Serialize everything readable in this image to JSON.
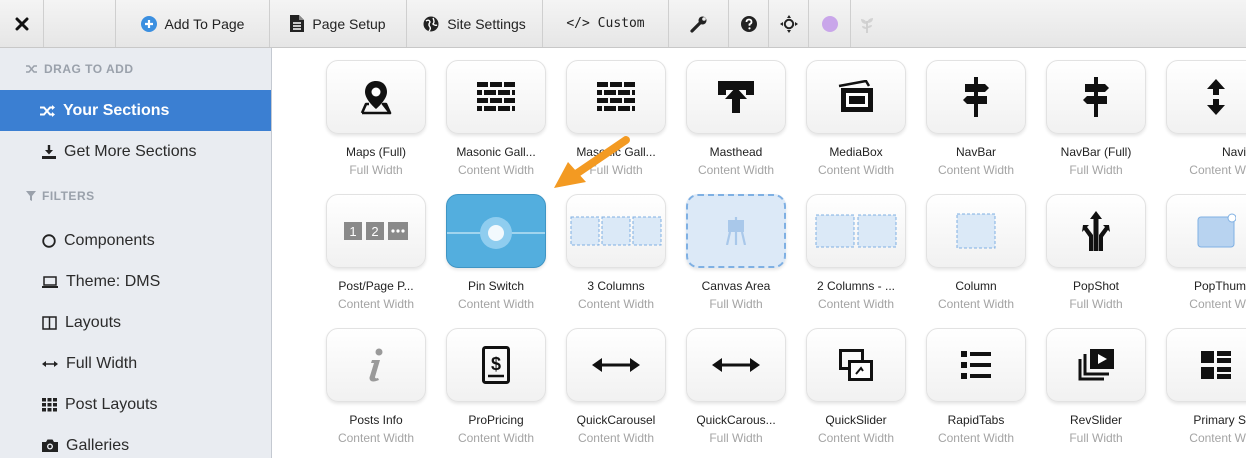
{
  "toolbar": {
    "add_label": "Add To Page",
    "setup_label": "Page Setup",
    "site_label": "Site Settings",
    "custom_label": "</> Custom"
  },
  "sidebar": {
    "drag_heading": "DRAG TO ADD",
    "filters_heading": "FILTERS",
    "items": [
      {
        "label": "Your Sections",
        "icon": "shuffle-icon"
      },
      {
        "label": "Get More Sections",
        "icon": "download-icon"
      },
      {
        "label": "Components",
        "icon": "circle-icon"
      },
      {
        "label": "Theme: DMS",
        "icon": "laptop-icon"
      },
      {
        "label": "Layouts",
        "icon": "columns-icon"
      },
      {
        "label": "Full Width",
        "icon": "arrows-horizontal-icon"
      },
      {
        "label": "Post Layouts",
        "icon": "grid-icon"
      },
      {
        "label": "Galleries",
        "icon": "camera-icon"
      }
    ]
  },
  "sections": {
    "rows": [
      [
        {
          "name": "Maps (Full)",
          "sub": "Full Width",
          "icon": "map-pin-icon"
        },
        {
          "name": "Masonic Gall...",
          "sub": "Content Width",
          "icon": "brick-wall-icon"
        },
        {
          "name": "Masonic Gall...",
          "sub": "Full Width",
          "icon": "brick-wall-icon"
        },
        {
          "name": "Masthead",
          "sub": "Content Width",
          "icon": "masthead-icon"
        },
        {
          "name": "MediaBox",
          "sub": "Content Width",
          "icon": "media-box-icon"
        },
        {
          "name": "NavBar",
          "sub": "Content Width",
          "icon": "signpost-icon"
        },
        {
          "name": "NavBar (Full)",
          "sub": "Full Width",
          "icon": "signpost-icon"
        },
        {
          "name": "Navi",
          "sub": "Content W",
          "icon": "up-down-arrow-icon"
        }
      ],
      [
        {
          "name": "Post/Page P...",
          "sub": "Content Width",
          "icon": "pagination-icon"
        },
        {
          "name": "Pin Switch",
          "sub": "Content Width",
          "icon": "pin-switch-icon"
        },
        {
          "name": "3 Columns",
          "sub": "Content Width",
          "icon": "three-columns-icon"
        },
        {
          "name": "Canvas Area",
          "sub": "Full Width",
          "icon": "easel-icon"
        },
        {
          "name": "2 Columns - ...",
          "sub": "Content Width",
          "icon": "two-columns-icon"
        },
        {
          "name": "Column",
          "sub": "Content Width",
          "icon": "column-icon"
        },
        {
          "name": "PopShot",
          "sub": "Full Width",
          "icon": "pop-arrows-icon"
        },
        {
          "name": "PopThum",
          "sub": "Content W",
          "icon": "pop-thumb-icon"
        }
      ],
      [
        {
          "name": "Posts Info",
          "sub": "Content Width",
          "icon": "info-icon"
        },
        {
          "name": "ProPricing",
          "sub": "Content Width",
          "icon": "pricing-icon"
        },
        {
          "name": "QuickCarousel",
          "sub": "Content Width",
          "icon": "carousel-arrows-icon"
        },
        {
          "name": "QuickCarous...",
          "sub": "Full Width",
          "icon": "carousel-arrows-icon"
        },
        {
          "name": "QuickSlider",
          "sub": "Content Width",
          "icon": "slider-icon"
        },
        {
          "name": "RapidTabs",
          "sub": "Content Width",
          "icon": "list-icon"
        },
        {
          "name": "RevSlider",
          "sub": "Full Width",
          "icon": "video-stack-icon"
        },
        {
          "name": "Primary S",
          "sub": "Content W",
          "icon": "grid-list-icon"
        }
      ]
    ]
  },
  "colors": {
    "accent": "#3b7fd2",
    "selected_tile": "#53aede",
    "arrow": "#f39a22"
  }
}
